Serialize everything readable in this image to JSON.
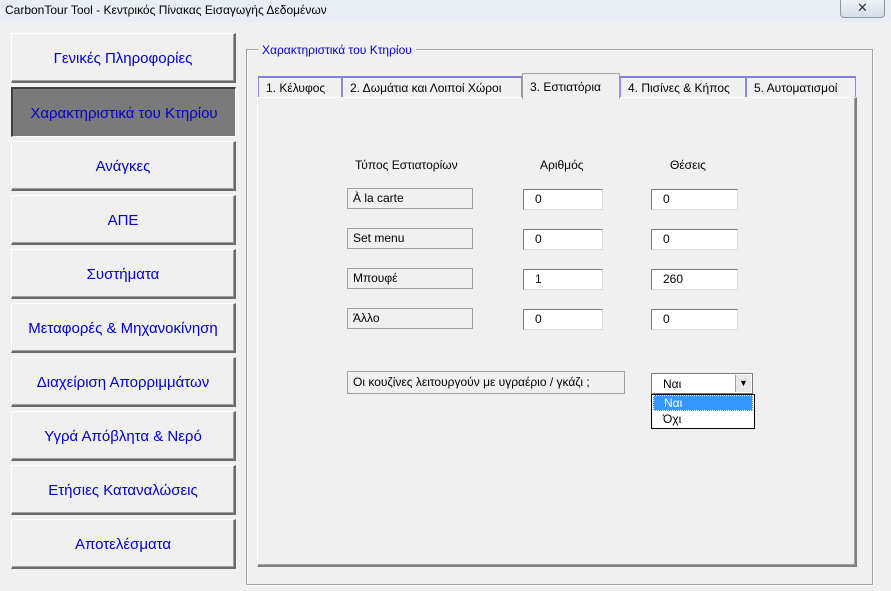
{
  "window": {
    "title": "CarbonTour Tool - Κεντρικός Πίνακας Εισαγωγής Δεδομένων",
    "close_label": "✕"
  },
  "nav": {
    "items": [
      {
        "label": "Γενικές Πληροφορίες"
      },
      {
        "label": "Χαρακτηριστικά του Κτηρίου",
        "active": true
      },
      {
        "label": "Ανάγκες"
      },
      {
        "label": "ΑΠΕ"
      },
      {
        "label": "Συστήματα"
      },
      {
        "label": "Μεταφορές & Μηχανοκίνηση"
      },
      {
        "label": "Διαχείριση Απορριμμάτων"
      },
      {
        "label": "Υγρά Απόβλητα & Νερό"
      },
      {
        "label": "Ετήσιες Καταναλώσεις"
      },
      {
        "label": "Αποτελέσματα"
      }
    ]
  },
  "frame": {
    "legend": "Χαρακτηριστικά του Κτηρίου"
  },
  "tabs": [
    {
      "label": "1.  Κέλυφος"
    },
    {
      "label": "2.  Δωμάτια και Λοιποί Χώροι"
    },
    {
      "label": "3.  Εστιατόρια",
      "active": true
    },
    {
      "label": "4.  Πισίνες & Κήπος"
    },
    {
      "label": "5.  Αυτοματισμοί"
    }
  ],
  "restaurants": {
    "headers": {
      "type": "Τύπος Εστιατορίων",
      "count": "Αριθμός",
      "seats": "Θέσεις"
    },
    "rows": [
      {
        "type": "À la carte",
        "count": "0",
        "seats": "0"
      },
      {
        "type": "Set menu",
        "count": "0",
        "seats": "0"
      },
      {
        "type": "Μπουφέ",
        "count": "1",
        "seats": "260"
      },
      {
        "type": "Άλλο",
        "count": "0",
        "seats": "0"
      }
    ]
  },
  "kitchen": {
    "question": "Οι κουζίνες λειτουργούν με υγραέριο / γκάζι ;",
    "selected": "Ναι",
    "options": [
      "Ναι",
      "Όχι"
    ]
  },
  "colors": {
    "accent": "#0000cc",
    "selection": "#3399ff"
  }
}
